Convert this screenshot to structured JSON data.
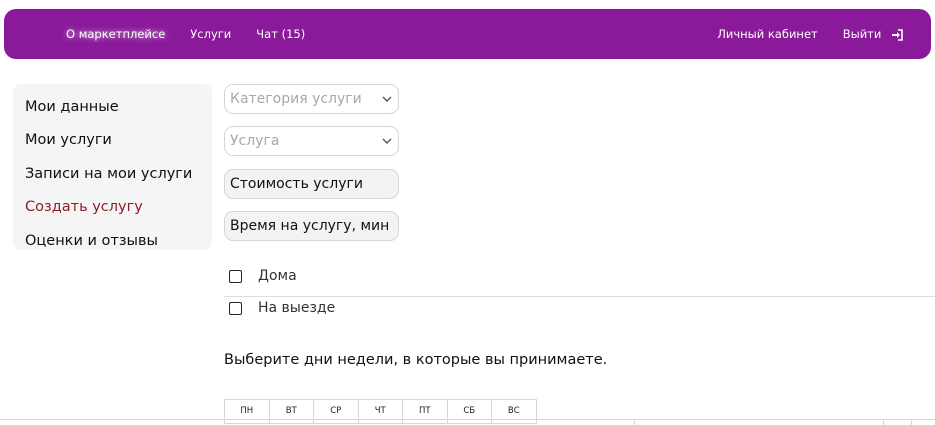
{
  "navbar": {
    "left": [
      {
        "label": "О маркетплейсе",
        "active": true
      },
      {
        "label": "Услуги",
        "active": false
      },
      {
        "label": "Чат (15)",
        "active": false
      }
    ],
    "account_label": "Личный кабинет",
    "logout_label": "Выйти",
    "logout_icon": "logout-icon",
    "bg_color": "#8a1a99"
  },
  "sidebar": {
    "items": [
      {
        "label": "Мои данные"
      },
      {
        "label": "Мои услуги"
      },
      {
        "label": "Записи на мои услуги"
      },
      {
        "label": "Создать услугу",
        "active": true
      },
      {
        "label": "Оценки и отзывы"
      }
    ],
    "active_color": "#8b1f28"
  },
  "form": {
    "category_placeholder": "Категория услуги",
    "service_placeholder": "Услуга",
    "price_value": "Стоимость услуги",
    "duration_value": "Время на услугу, мин",
    "options": [
      {
        "label": "Дома",
        "checked": false
      },
      {
        "label": "На выезде",
        "checked": false
      }
    ],
    "days_prompt": "Выберите дни недели, в которые вы принимаете.",
    "days": [
      "ПН",
      "ВТ",
      "СР",
      "ЧТ",
      "ПТ",
      "СБ",
      "ВС"
    ]
  }
}
